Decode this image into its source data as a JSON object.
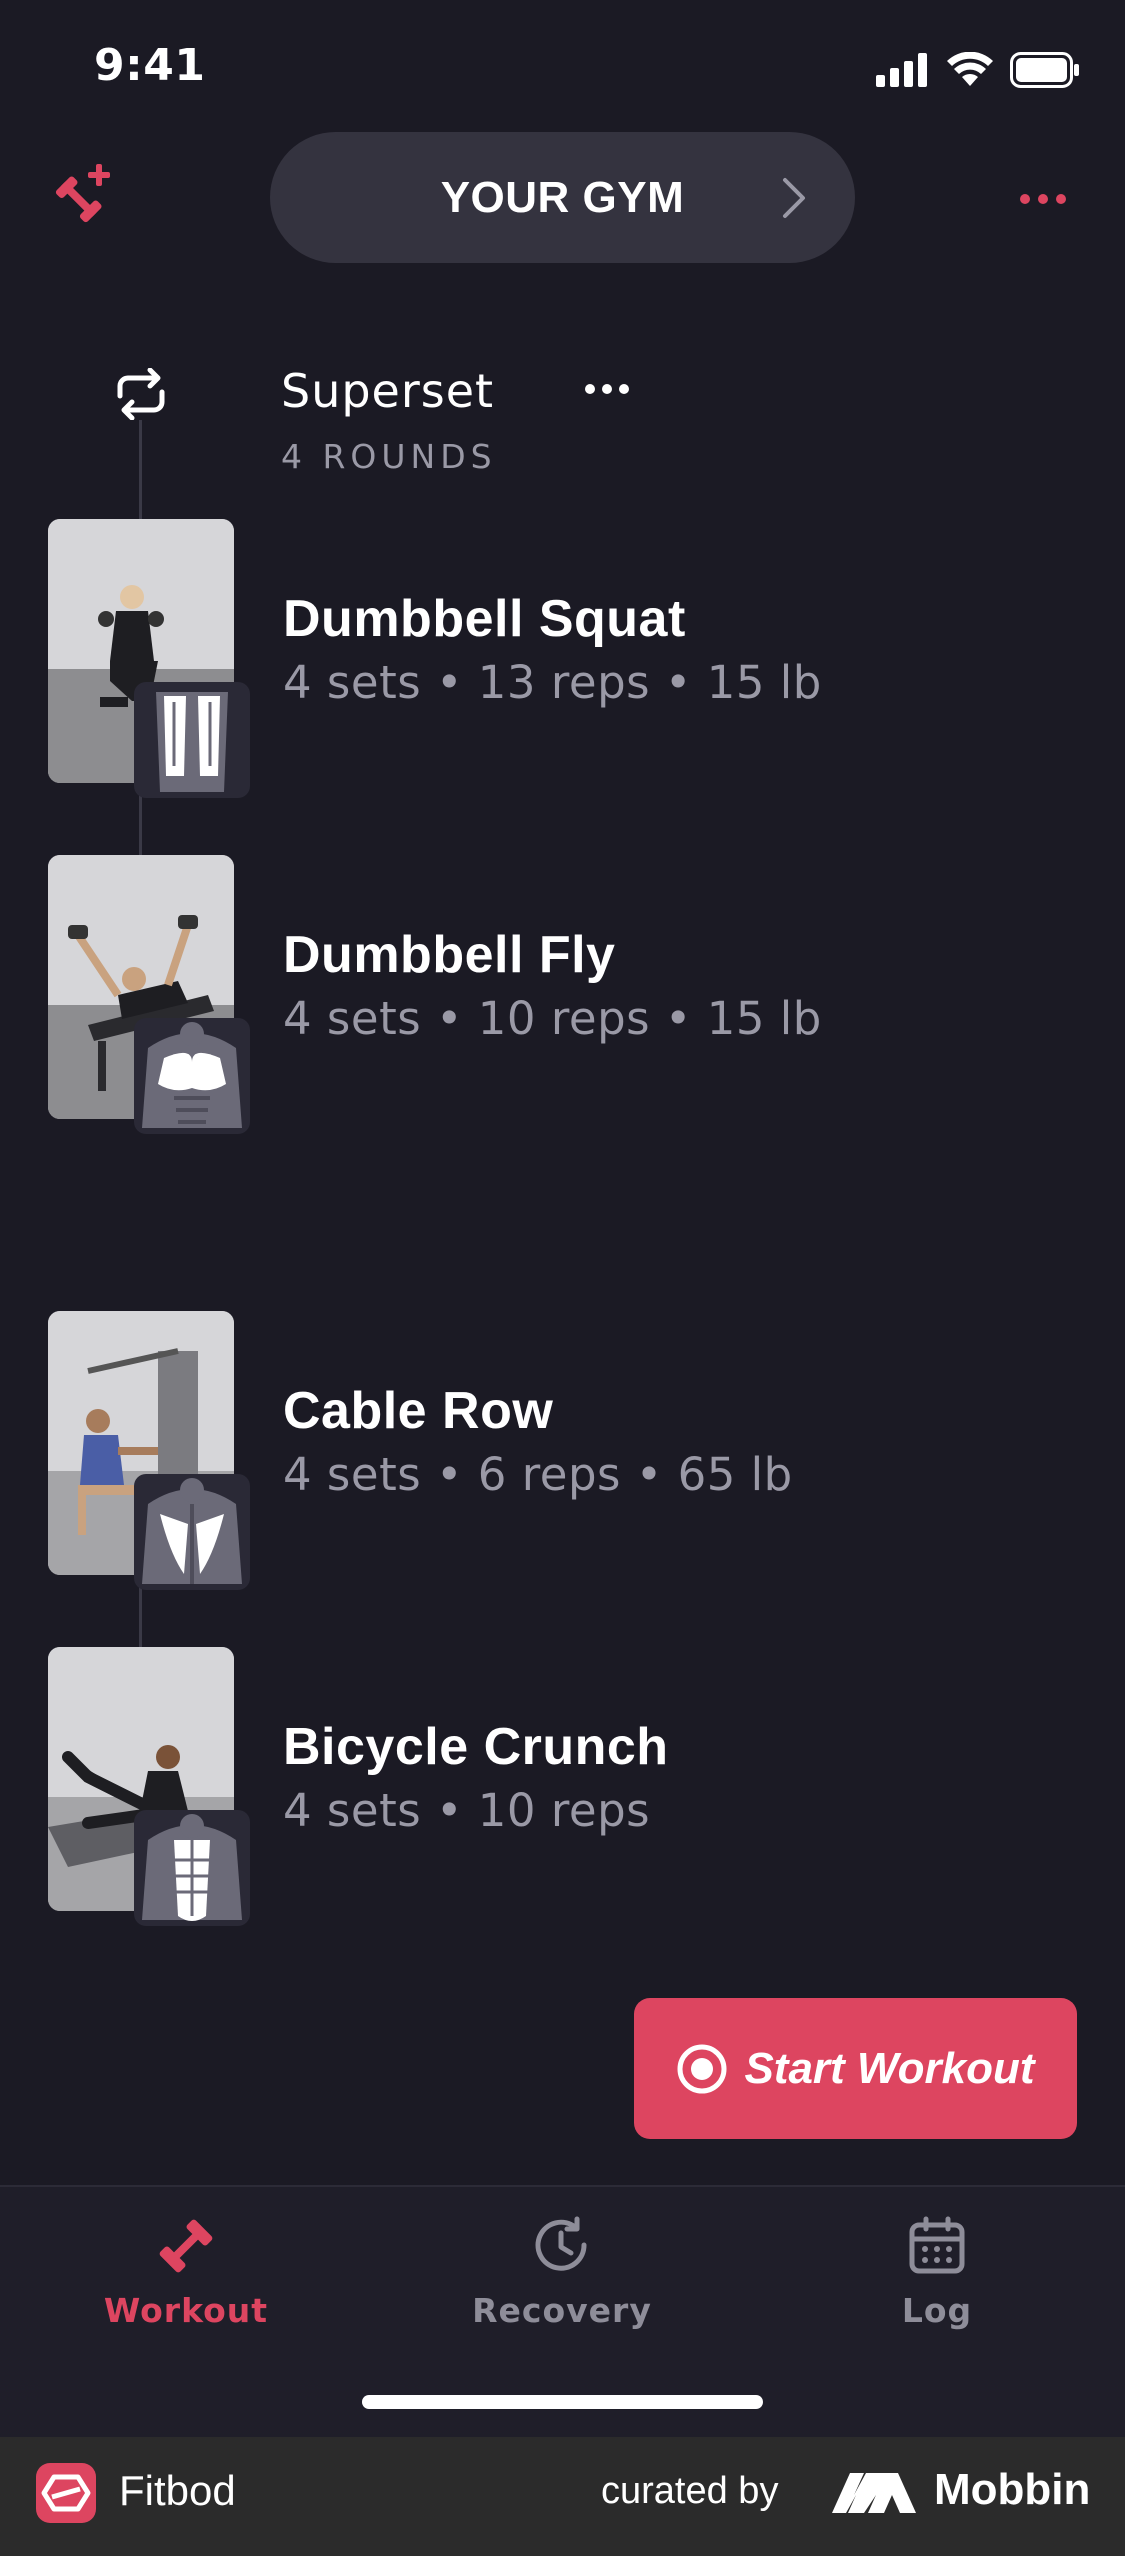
{
  "status_bar": {
    "time": "9:41"
  },
  "header": {
    "gym_label": "YOUR GYM"
  },
  "superset": {
    "title": "Superset",
    "rounds": "4 ROUNDS"
  },
  "exercises": [
    {
      "name": "Dumbbell Squat",
      "detail": "4 sets • 13 reps • 15 lb",
      "muscle": "quadriceps"
    },
    {
      "name": "Dumbbell Fly",
      "detail": "4 sets • 10 reps • 15 lb",
      "muscle": "chest"
    },
    {
      "name": "Cable Row",
      "detail": "4 sets • 6 reps • 65 lb",
      "muscle": "back"
    },
    {
      "name": "Bicycle Crunch",
      "detail": "4 sets • 10 reps",
      "muscle": "abs"
    }
  ],
  "start_button": {
    "label": "Start Workout"
  },
  "tabs": [
    {
      "label": "Workout",
      "icon": "dumbbell-icon",
      "active": true
    },
    {
      "label": "Recovery",
      "icon": "recovery-clock-icon",
      "active": false
    },
    {
      "label": "Log",
      "icon": "calendar-icon",
      "active": false
    }
  ],
  "footer": {
    "app_name": "Fitbod",
    "curated_by": "curated by",
    "brand": "Mobbin"
  },
  "colors": {
    "accent": "#dd4560",
    "background": "#1b1a24",
    "muted_text": "#9a99a6"
  }
}
